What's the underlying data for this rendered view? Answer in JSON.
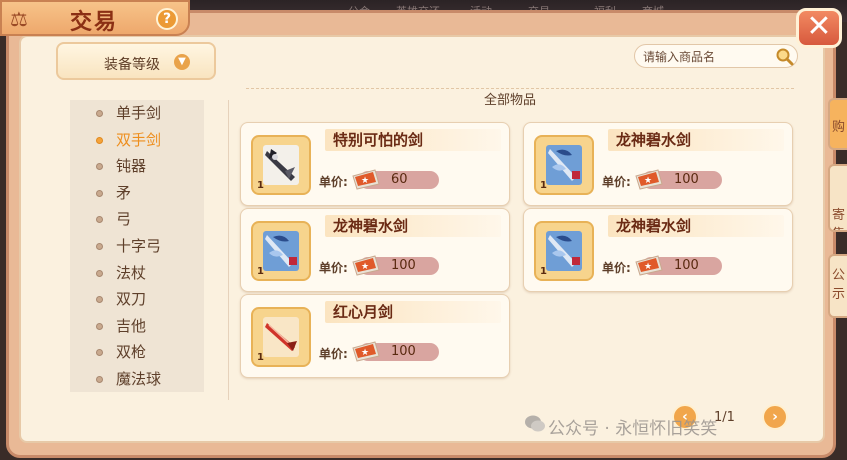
{
  "title": "交易",
  "help_label": "?",
  "close_label": "✕",
  "top_strip_ghost_tabs": [
    "公会",
    "英雄交还",
    "活动",
    "交易",
    "福利",
    "商城"
  ],
  "side_tabs": [
    "购",
    "寄售",
    "公示"
  ],
  "level_dropdown": {
    "label": "装备等级"
  },
  "search": {
    "placeholder": "请输入商品名"
  },
  "categories": [
    {
      "label": "单手剑",
      "active": false
    },
    {
      "label": "双手剑",
      "active": true
    },
    {
      "label": "钝器",
      "active": false
    },
    {
      "label": "矛",
      "active": false
    },
    {
      "label": "弓",
      "active": false
    },
    {
      "label": "十字弓",
      "active": false
    },
    {
      "label": "法杖",
      "active": false
    },
    {
      "label": "双刀",
      "active": false
    },
    {
      "label": "吉他",
      "active": false
    },
    {
      "label": "双枪",
      "active": false
    },
    {
      "label": "魔法球",
      "active": false
    }
  ],
  "section_title": "全部物品",
  "price_label": "单价:",
  "items": [
    {
      "name": "特别可怕的剑",
      "qty": "1",
      "price": "60",
      "icon": "dark-sword-icon"
    },
    {
      "name": "龙神碧水剑",
      "qty": "1",
      "price": "100",
      "icon": "dragon-sword-icon"
    },
    {
      "name": "龙神碧水剑",
      "qty": "1",
      "price": "100",
      "icon": "dragon-sword-icon"
    },
    {
      "name": "龙神碧水剑",
      "qty": "1",
      "price": "100",
      "icon": "dragon-sword-icon"
    },
    {
      "name": "红心月剑",
      "qty": "1",
      "price": "100",
      "icon": "red-sword-icon"
    }
  ],
  "pagination": {
    "current": "1/1",
    "prev": "‹",
    "next": "›"
  },
  "watermark": "公众号 · 永恒怀旧笑笑",
  "colors": {
    "accent": "#ee8e1d",
    "title": "#8b2f14",
    "panel": "#fbf1df",
    "frame": "#e9b996"
  }
}
